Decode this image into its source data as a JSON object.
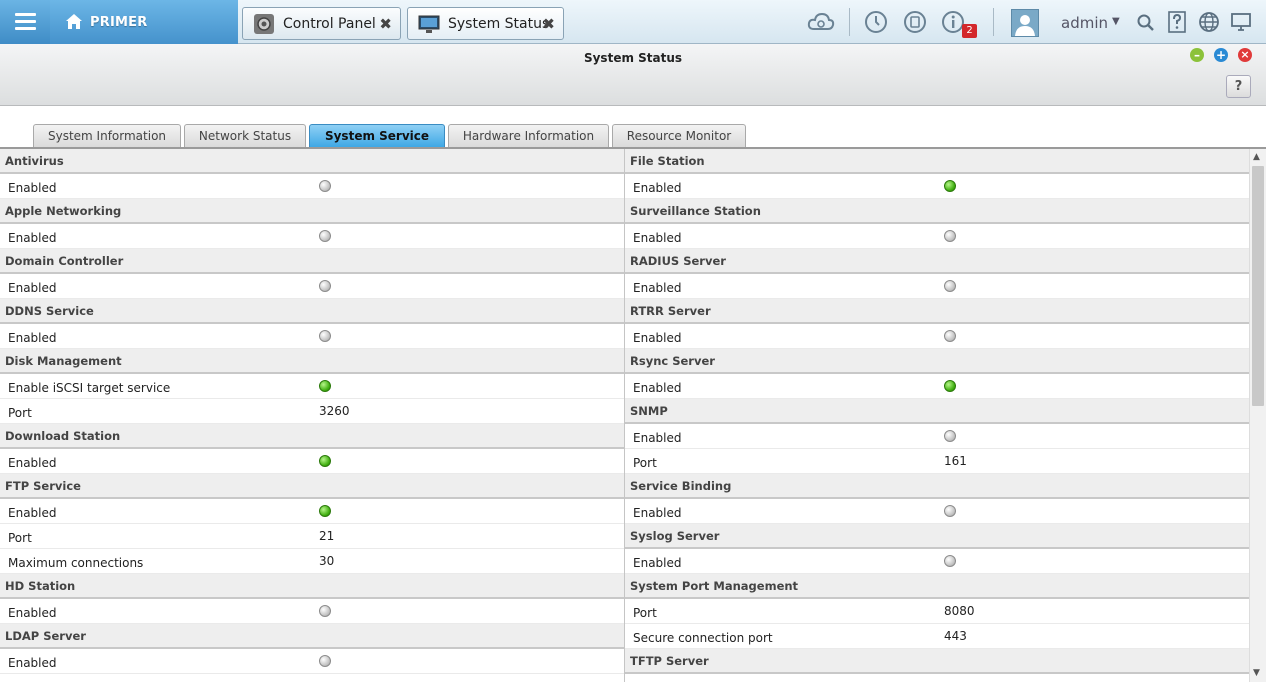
{
  "topbar": {
    "home_label": "PRIMER",
    "tabs": [
      {
        "label": "Control Panel",
        "close": "✖"
      },
      {
        "label": "System Status",
        "close": "✖"
      }
    ],
    "notification_count": "2",
    "user": "admin"
  },
  "window": {
    "title": "System Status",
    "help": "?"
  },
  "subtabs": [
    "System Information",
    "Network Status",
    "System Service",
    "Hardware Information",
    "Resource Monitor"
  ],
  "left": [
    {
      "title": "Antivirus",
      "rows": [
        {
          "label": "Enabled",
          "status": "off"
        }
      ]
    },
    {
      "title": "Apple Networking",
      "rows": [
        {
          "label": "Enabled",
          "status": "off"
        }
      ]
    },
    {
      "title": "Domain Controller",
      "rows": [
        {
          "label": "Enabled",
          "status": "off"
        }
      ]
    },
    {
      "title": "DDNS Service",
      "rows": [
        {
          "label": "Enabled",
          "status": "off"
        }
      ]
    },
    {
      "title": "Disk Management",
      "rows": [
        {
          "label": "Enable iSCSI target service",
          "status": "on"
        },
        {
          "label": "Port",
          "value": "3260"
        }
      ]
    },
    {
      "title": "Download Station",
      "rows": [
        {
          "label": "Enabled",
          "status": "on"
        }
      ]
    },
    {
      "title": "FTP Service",
      "rows": [
        {
          "label": "Enabled",
          "status": "on"
        },
        {
          "label": "Port",
          "value": "21"
        },
        {
          "label": "Maximum connections",
          "value": "30"
        }
      ]
    },
    {
      "title": "HD Station",
      "rows": [
        {
          "label": "Enabled",
          "status": "off"
        }
      ]
    },
    {
      "title": "LDAP Server",
      "rows": [
        {
          "label": "Enabled",
          "status": "off"
        }
      ]
    }
  ],
  "right": [
    {
      "title": "File Station",
      "rows": [
        {
          "label": "Enabled",
          "status": "on"
        }
      ]
    },
    {
      "title": "Surveillance Station",
      "rows": [
        {
          "label": "Enabled",
          "status": "off"
        }
      ]
    },
    {
      "title": "RADIUS Server",
      "rows": [
        {
          "label": "Enabled",
          "status": "off"
        }
      ]
    },
    {
      "title": "RTRR Server",
      "rows": [
        {
          "label": "Enabled",
          "status": "off"
        }
      ]
    },
    {
      "title": "Rsync Server",
      "rows": [
        {
          "label": "Enabled",
          "status": "on"
        }
      ]
    },
    {
      "title": "SNMP",
      "rows": [
        {
          "label": "Enabled",
          "status": "off"
        },
        {
          "label": "Port",
          "value": "161"
        }
      ]
    },
    {
      "title": "Service Binding",
      "rows": [
        {
          "label": "Enabled",
          "status": "off"
        }
      ]
    },
    {
      "title": "Syslog Server",
      "rows": [
        {
          "label": "Enabled",
          "status": "off"
        }
      ]
    },
    {
      "title": "System Port Management",
      "rows": [
        {
          "label": "Port",
          "value": "8080"
        },
        {
          "label": "Secure connection port",
          "value": "443"
        }
      ]
    },
    {
      "title": "TFTP Server",
      "rows": []
    }
  ]
}
